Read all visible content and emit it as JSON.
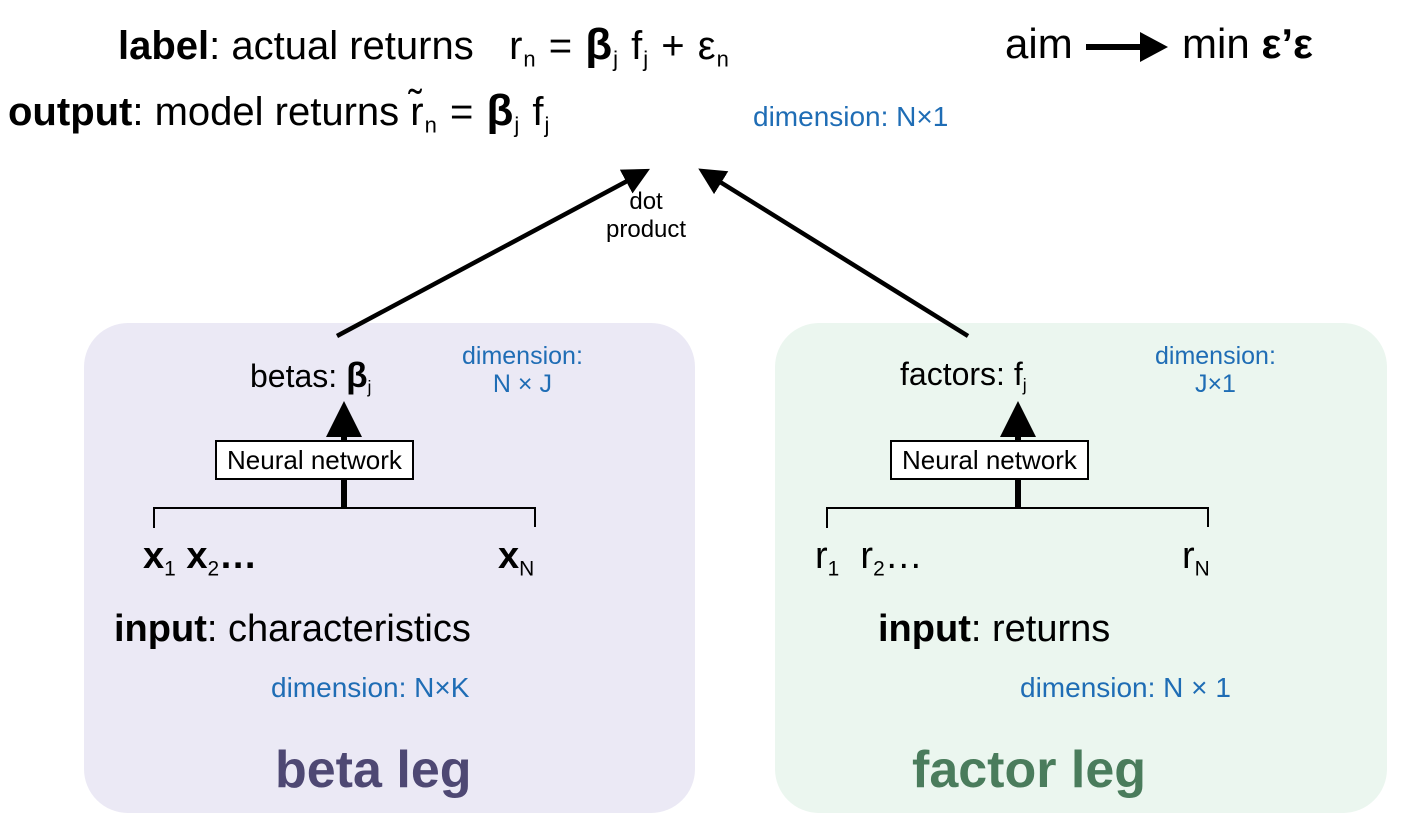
{
  "header": {
    "label_line": {
      "keyword": "label",
      "text": ": actual returns",
      "equation": {
        "lhs": "r",
        "lhs_sub": "n",
        "eq": "=",
        "beta": "β",
        "beta_sub": "j",
        "f": "f",
        "f_sub": "j",
        "plus": "+",
        "eps": "ε",
        "eps_sub": "n"
      }
    },
    "aim": {
      "word": "aim",
      "arrow_icon": "right-arrow",
      "target_prefix": "min",
      "target_expr": "ε’ε"
    },
    "output_line": {
      "keyword": "output",
      "text": ": model returns",
      "equation": {
        "lhs": "r̃",
        "lhs_sub": "n",
        "eq": "=",
        "beta": "β",
        "beta_sub": "j",
        "f": "f",
        "f_sub": "j"
      },
      "dimension": "dimension: N×1"
    }
  },
  "dot_product": {
    "line1": "dot",
    "line2": "product"
  },
  "beta_leg": {
    "color_bg": "#ebe9f5",
    "title_color": "#4e4873",
    "output_label": "betas: ",
    "output_symbol": "β",
    "output_sub": "j",
    "dimension_line1": "dimension:",
    "dimension_line2": "N × J",
    "network_label": "Neural network",
    "inputs": [
      {
        "symbol": "x",
        "sub": "1"
      },
      {
        "symbol": "x",
        "sub": "2"
      },
      {
        "ellipsis": "…"
      },
      {
        "symbol": "x",
        "sub": "N"
      }
    ],
    "input_keyword": "input",
    "input_text": ": characteristics",
    "input_dimension": "dimension: N×K",
    "title": "beta leg"
  },
  "factor_leg": {
    "color_bg": "#ebf6ef",
    "title_color": "#4a7c5c",
    "output_label": "factors: ",
    "output_symbol": "f",
    "output_sub": "j",
    "dimension_line1": "dimension:",
    "dimension_line2": "J×1",
    "network_label": "Neural network",
    "inputs": [
      {
        "symbol": "r",
        "sub": "1"
      },
      {
        "symbol": "r",
        "sub": "2"
      },
      {
        "ellipsis": "…"
      },
      {
        "symbol": "r",
        "sub": "N"
      }
    ],
    "input_keyword": "input",
    "input_text": ": returns",
    "input_dimension": "dimension: N × 1",
    "title": "factor leg"
  }
}
